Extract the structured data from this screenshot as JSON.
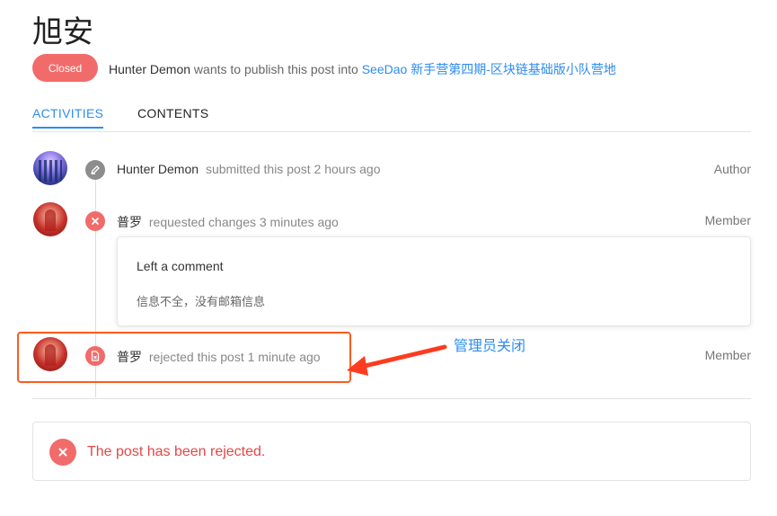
{
  "post": {
    "title": "旭安",
    "status": "Closed",
    "publish_author": "Hunter Demon",
    "publish_text": " wants to publish this post into ",
    "publish_target": "SeeDao 新手营第四期-区块链基础版小队营地"
  },
  "tabs": [
    {
      "label": "ACTIVITIES",
      "active": true
    },
    {
      "label": "CONTENTS",
      "active": false
    }
  ],
  "activities": [
    {
      "user": "Hunter Demon",
      "action": "submitted this post 2 hours ago",
      "role": "Author",
      "icon": "pen-icon"
    },
    {
      "user": "普罗",
      "action": "requested changes 3 minutes ago",
      "role": "Member",
      "icon": "close-icon"
    },
    {
      "user": "普罗",
      "action": "rejected this post 1 minute ago",
      "role": "Member",
      "icon": "document-icon"
    }
  ],
  "comment": {
    "title": "Left a comment",
    "body": "信息不全，没有邮箱信息"
  },
  "annotation": {
    "text": "管理员关闭"
  },
  "alert": {
    "text": "The post has been rejected."
  },
  "colors": {
    "accent": "#2d8cf0",
    "danger": "#f26b6b",
    "annotation_box": "#ff5a1f"
  }
}
